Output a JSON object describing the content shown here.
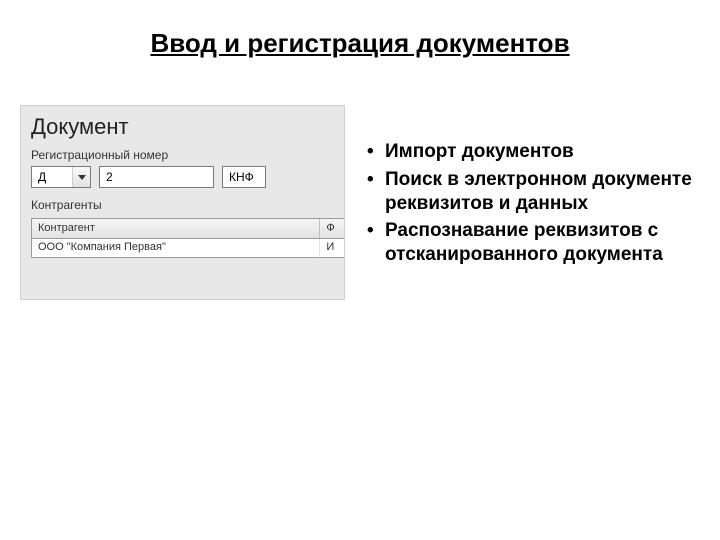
{
  "title": "Ввод и регистрация документов",
  "panel": {
    "heading": "Документ",
    "regnum_label": "Регистрационный номер",
    "prefix_value": "Д",
    "number_value": "2",
    "suffix_value": "КНФ",
    "contragents_label": "Контрагенты",
    "grid": {
      "col1": "Контрагент",
      "col2": "Ф",
      "row1_col1": "ООО \"Компания Первая\"",
      "row1_col2": "И"
    }
  },
  "bullets": {
    "b1": "Импорт документов",
    "b2": "Поиск в электронном документе реквизитов и данных",
    "b3": "Распознавание реквизитов с отсканированного документа"
  }
}
